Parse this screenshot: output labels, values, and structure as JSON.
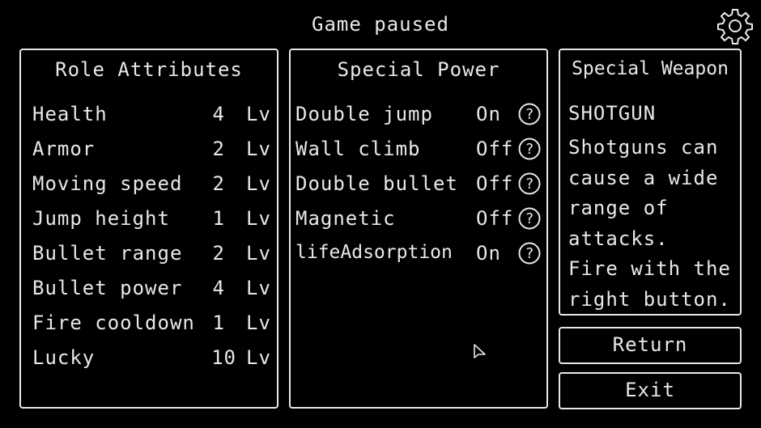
{
  "header": {
    "title": "Game paused",
    "settings_icon": "gear-icon"
  },
  "attributes": {
    "title": "Role Attributes",
    "items": [
      {
        "label": "Health",
        "value": "4",
        "unit": "Lv"
      },
      {
        "label": "Armor",
        "value": "2",
        "unit": "Lv"
      },
      {
        "label": "Moving speed",
        "value": "2",
        "unit": "Lv"
      },
      {
        "label": "Jump height",
        "value": "1",
        "unit": "Lv"
      },
      {
        "label": "Bullet range",
        "value": "2",
        "unit": "Lv"
      },
      {
        "label": "Bullet power",
        "value": "4",
        "unit": "Lv"
      },
      {
        "label": "Fire cooldown",
        "value": "1",
        "unit": "Lv"
      },
      {
        "label": "Lucky",
        "value": "10",
        "unit": "Lv"
      }
    ]
  },
  "powers": {
    "title": "Special Power",
    "items": [
      {
        "label": "Double jump",
        "state": "On"
      },
      {
        "label": "Wall climb",
        "state": "Off"
      },
      {
        "label": "Double bullet",
        "state": "Off"
      },
      {
        "label": "Magnetic",
        "state": "Off"
      },
      {
        "label": "lifeAdsorption",
        "state": "On"
      }
    ],
    "help_icon": "question-circle-icon"
  },
  "weapon": {
    "title": "Special Weapon",
    "name": "SHOTGUN",
    "description": "Shotguns can\ncause a wide\nrange of\nattacks.\nFire with the\nright button."
  },
  "buttons": {
    "return_label": "Return",
    "exit_label": "Exit"
  }
}
